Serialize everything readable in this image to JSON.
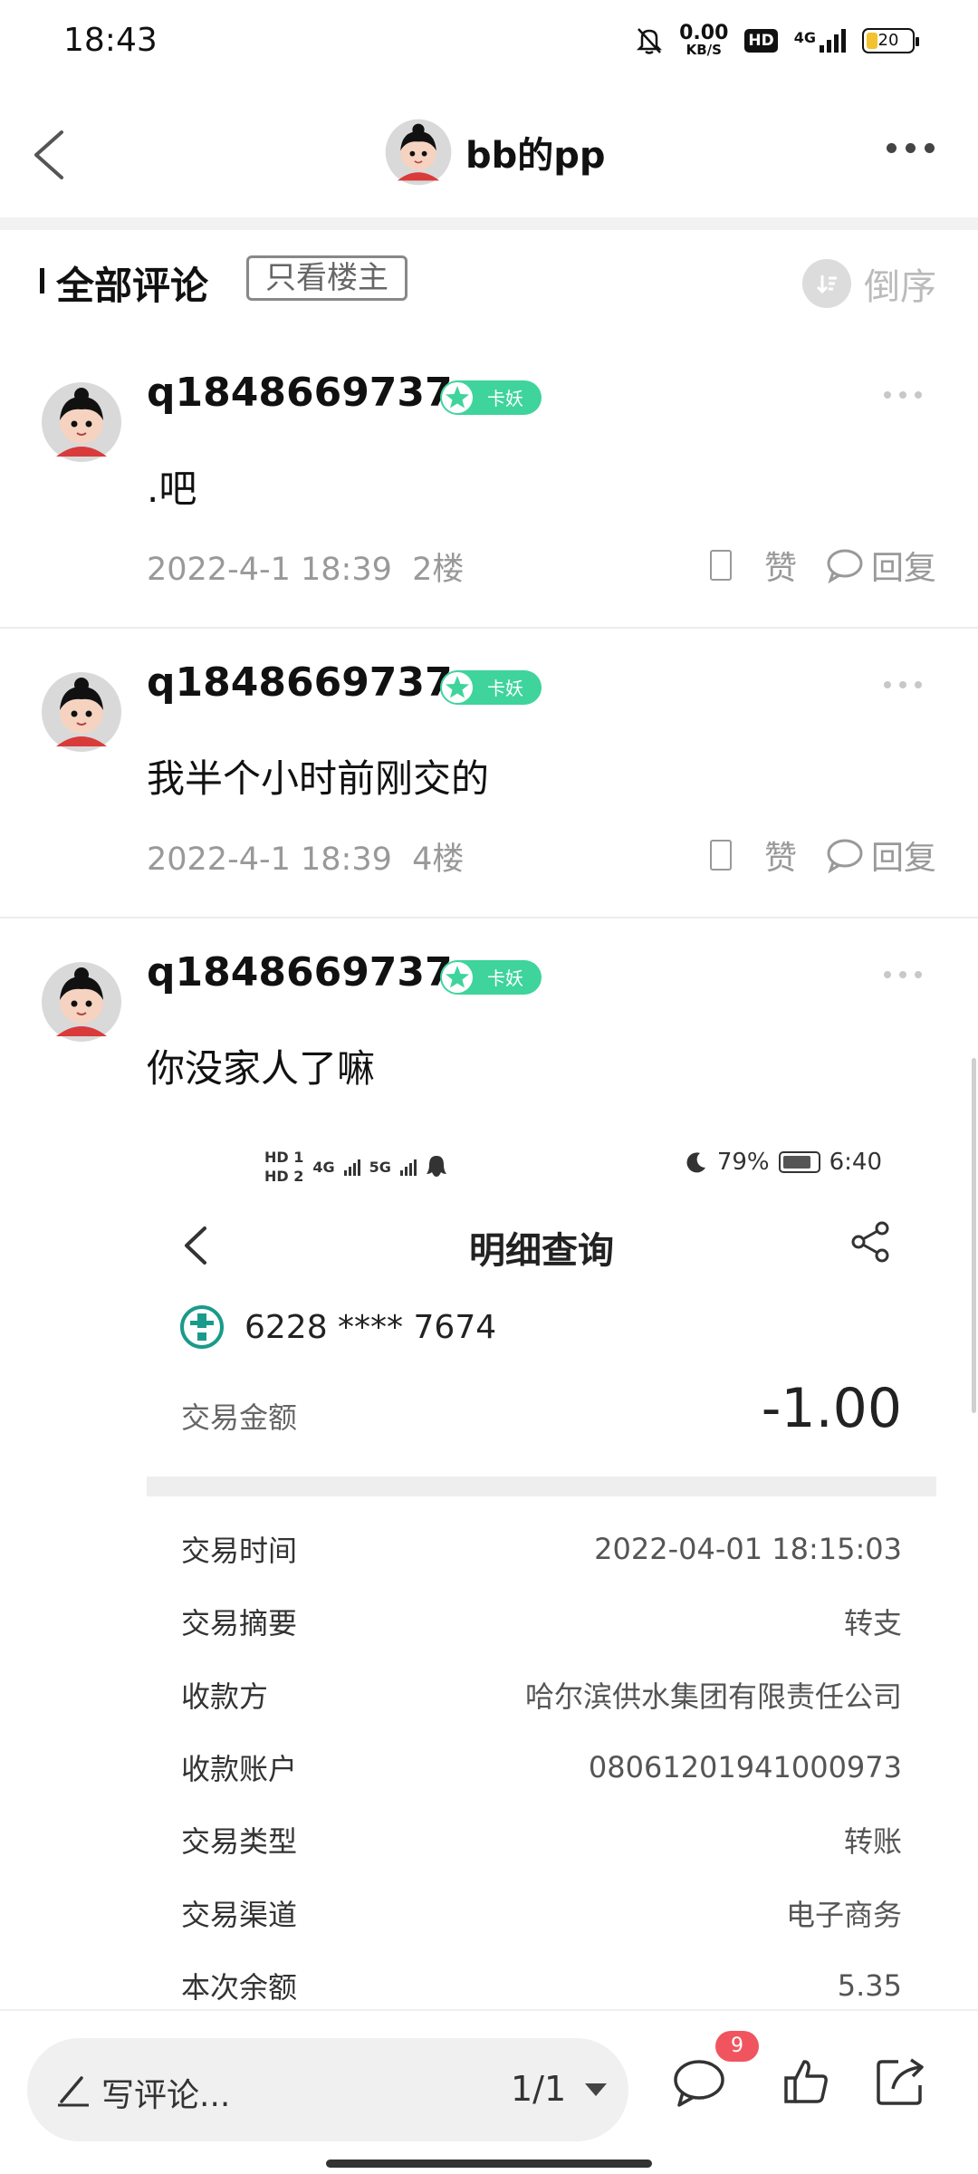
{
  "status_bar": {
    "time": "18:43",
    "net_speed": "0.00",
    "net_unit": "KB/S",
    "hd": "HD",
    "network": "4G",
    "battery": "20"
  },
  "header": {
    "title": "bb的pp"
  },
  "comments_header": {
    "title": "全部评论",
    "op_only_label": "只看楼主",
    "sort_label": "倒序"
  },
  "comments": [
    {
      "username": "q1848669737",
      "badge": "卡妖",
      "text": ".吧",
      "time": "2022-4-1 18:39",
      "floor": "2楼",
      "like_label": "赞",
      "reply_label": "回复"
    },
    {
      "username": "q1848669737",
      "badge": "卡妖",
      "text": "我半个小时前刚交的",
      "time": "2022-4-1 18:39",
      "floor": "4楼",
      "like_label": "赞",
      "reply_label": "回复"
    },
    {
      "username": "q1848669737",
      "badge": "卡妖",
      "text": "你没家人了嘛"
    }
  ],
  "embedded_screenshot": {
    "status_left_hd1": "HD 1",
    "status_left_hd2": "HD 2",
    "status_net1": "4G",
    "status_net2": "5G",
    "battery_pct": "79%",
    "time": "6:40",
    "title": "明细查询",
    "card_number": "6228 **** 7674",
    "amount_label": "交易金额",
    "amount_value": "-1.00",
    "rows": [
      {
        "key": "交易时间",
        "value": "2022-04-01 18:15:03"
      },
      {
        "key": "交易摘要",
        "value": "转支"
      },
      {
        "key": "收款方",
        "value": "哈尔滨供水集团有限责任公司"
      },
      {
        "key": "收款账户",
        "value": "08061201941000973"
      },
      {
        "key": "交易类型",
        "value": "转账"
      },
      {
        "key": "交易渠道",
        "value": "电子商务"
      },
      {
        "key": "本次余额",
        "value": "5.35"
      }
    ]
  },
  "bottom_bar": {
    "write_placeholder": "写评论...",
    "page_indicator": "1/1",
    "comment_count": "9"
  },
  "colors": {
    "accent_green": "#3ed49c",
    "badge_red": "#f0555f",
    "muted_text": "#999999"
  }
}
